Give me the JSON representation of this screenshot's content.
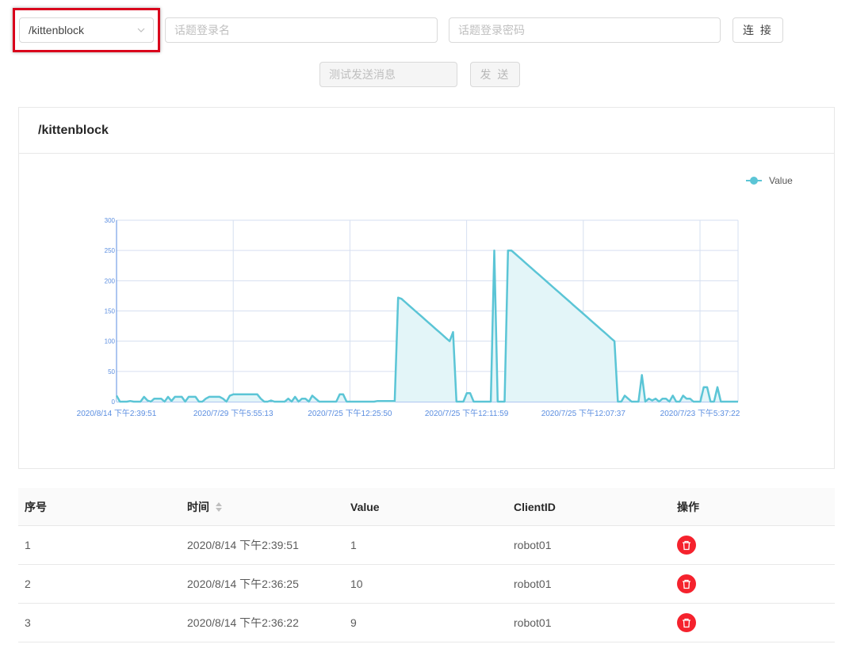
{
  "toolbar": {
    "topic_selected": "/kittenblock",
    "username_placeholder": "话题登录名",
    "password_placeholder": "话题登录密码",
    "connect_label": "连 接",
    "test_message_placeholder": "测试发送消息",
    "send_label": "发 送"
  },
  "card": {
    "title": "/kittenblock"
  },
  "colors": {
    "series": "#5bc5d6",
    "area": "#e3f5f8",
    "grid": "#d6dff0",
    "axis_label": "#5b8ee0",
    "danger": "#f5222d"
  },
  "chart_data": {
    "type": "line",
    "legend": [
      "Value"
    ],
    "legend_position": "top-right",
    "ylim": [
      0,
      300
    ],
    "yticks": [
      0,
      50,
      100,
      150,
      200,
      250,
      300
    ],
    "xtick_labels": [
      "2020/8/14 下午2:39:51",
      "2020/7/29 下午5:55:13",
      "2020/7/25 下午12:25:50",
      "2020/7/25 下午12:11:59",
      "2020/7/25 下午12:07:37",
      "2020/7/23 下午5:37:22"
    ],
    "grid": true,
    "area_fill": true,
    "series": [
      {
        "name": "Value",
        "values": [
          10,
          0,
          0,
          0,
          1,
          0,
          0,
          0,
          8,
          2,
          0,
          5,
          5,
          5,
          0,
          8,
          1,
          8,
          8,
          8,
          0,
          8,
          8,
          8,
          0,
          0,
          5,
          8,
          8,
          8,
          8,
          5,
          0,
          10,
          12,
          12,
          12,
          12,
          12,
          12,
          12,
          12,
          5,
          0,
          0,
          2,
          0,
          0,
          0,
          0,
          5,
          0,
          8,
          0,
          5,
          5,
          0,
          10,
          5,
          0,
          0,
          0,
          0,
          0,
          0,
          12,
          12,
          0,
          0,
          0,
          0,
          0,
          0,
          0,
          0,
          0,
          1,
          1,
          1,
          1,
          1,
          1,
          172,
          170,
          165,
          160,
          155,
          150,
          145,
          140,
          135,
          130,
          125,
          120,
          115,
          110,
          105,
          100,
          115,
          0,
          0,
          0,
          14,
          14,
          0,
          0,
          0,
          0,
          0,
          0,
          250,
          0,
          0,
          0,
          250,
          250,
          245,
          240,
          235,
          230,
          225,
          220,
          215,
          210,
          205,
          200,
          195,
          190,
          185,
          180,
          175,
          170,
          165,
          160,
          155,
          150,
          145,
          140,
          135,
          130,
          125,
          120,
          115,
          110,
          105,
          100,
          0,
          0,
          10,
          5,
          0,
          0,
          0,
          44,
          0,
          5,
          2,
          5,
          0,
          5,
          5,
          0,
          10,
          0,
          0,
          10,
          5,
          5,
          0,
          0,
          0,
          24,
          24,
          0,
          0,
          24,
          0,
          0,
          0,
          0,
          0,
          0
        ]
      }
    ]
  },
  "table": {
    "headers": [
      "序号",
      "时间",
      "Value",
      "ClientID",
      "操作"
    ],
    "rows": [
      {
        "idx": "1",
        "time": "2020/8/14 下午2:39:51",
        "value": "1",
        "client": "robot01"
      },
      {
        "idx": "2",
        "time": "2020/8/14 下午2:36:25",
        "value": "10",
        "client": "robot01"
      },
      {
        "idx": "3",
        "time": "2020/8/14 下午2:36:22",
        "value": "9",
        "client": "robot01"
      }
    ]
  }
}
